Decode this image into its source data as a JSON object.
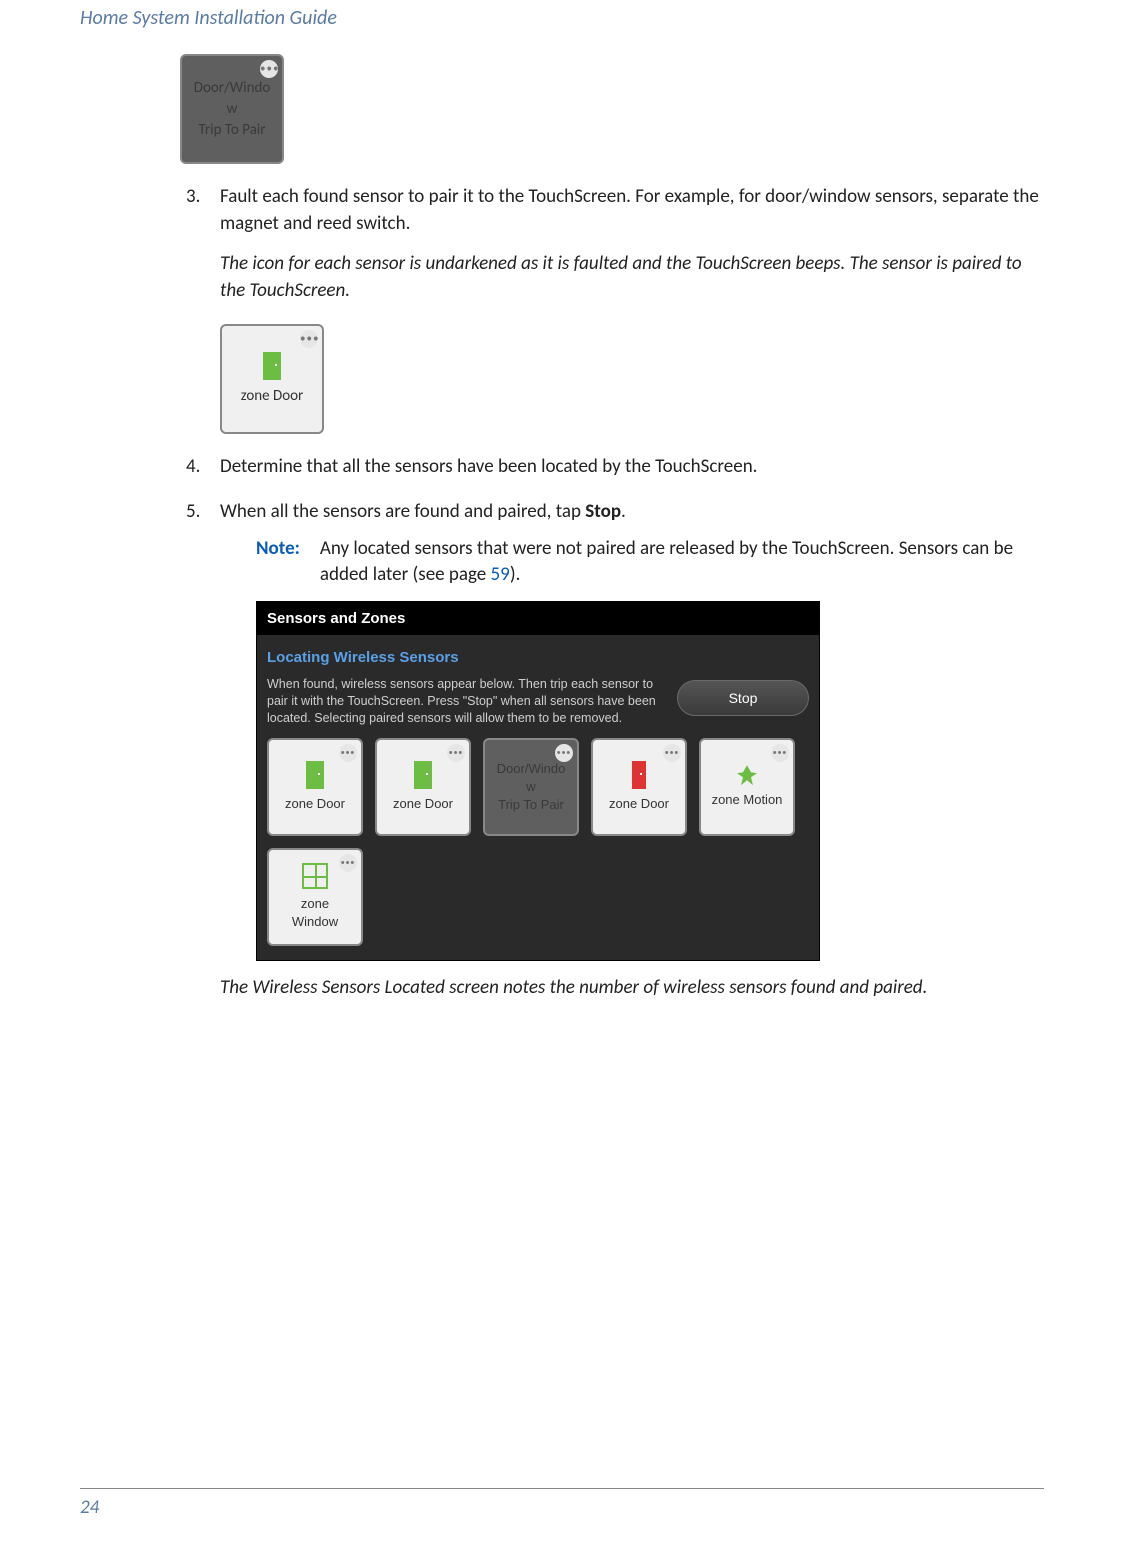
{
  "header": {
    "title": "Home System Installation Guide"
  },
  "figure1": {
    "menu": "•••",
    "line1": "Door/Windo",
    "line2": "w",
    "line3": "Trip To Pair"
  },
  "steps": {
    "s3": {
      "text": "Fault each found sensor to pair it to the TouchScreen. For example, for door/window sensors, separate the magnet and reed switch.",
      "em": "The icon for each sensor is undarkened as it is faulted and the TouchScreen beeps. The sensor is paired to the TouchScreen."
    },
    "s4": {
      "text": "Determine that all the sensors have been located by the TouchScreen."
    },
    "s5": {
      "prefix": "When all the sensors are found and paired, tap ",
      "bold": "Stop",
      "suffix": "."
    }
  },
  "figure2": {
    "menu": "•••",
    "label": "zone Door"
  },
  "note": {
    "label": "Note:",
    "body_prefix": "Any located sensors that were not paired are released by the TouchScreen. Sensors can be added later (see page ",
    "page": "59",
    "body_suffix": ")."
  },
  "screen": {
    "title": "Sensors and Zones",
    "subtitle": "Locating Wireless Sensors",
    "help": "When found, wireless sensors appear below.  Then trip each sensor to pair it with the TouchScreen.  Press \"Stop\" when all sensors have been located.  Selecting paired sensors will allow them to be removed.",
    "stop": "Stop",
    "tiles": [
      {
        "type": "door",
        "paired": true,
        "label": "zone Door",
        "menu": "•••"
      },
      {
        "type": "door",
        "paired": true,
        "label": "zone Door",
        "menu": "•••"
      },
      {
        "type": "unpaired",
        "paired": false,
        "l1": "Door/Windo",
        "l2": "w",
        "l3": "Trip To Pair",
        "menu": "•••"
      },
      {
        "type": "door-open",
        "paired": true,
        "label": "zone Door",
        "menu": "•••"
      },
      {
        "type": "motion",
        "paired": true,
        "label": "zone Motion",
        "menu": "•••"
      },
      {
        "type": "window",
        "paired": true,
        "l1": "zone",
        "l2": "Window",
        "menu": "•••"
      }
    ]
  },
  "caption": "The Wireless Sensors Located screen notes the number of wireless sensors found and paired.",
  "page_number": "24"
}
